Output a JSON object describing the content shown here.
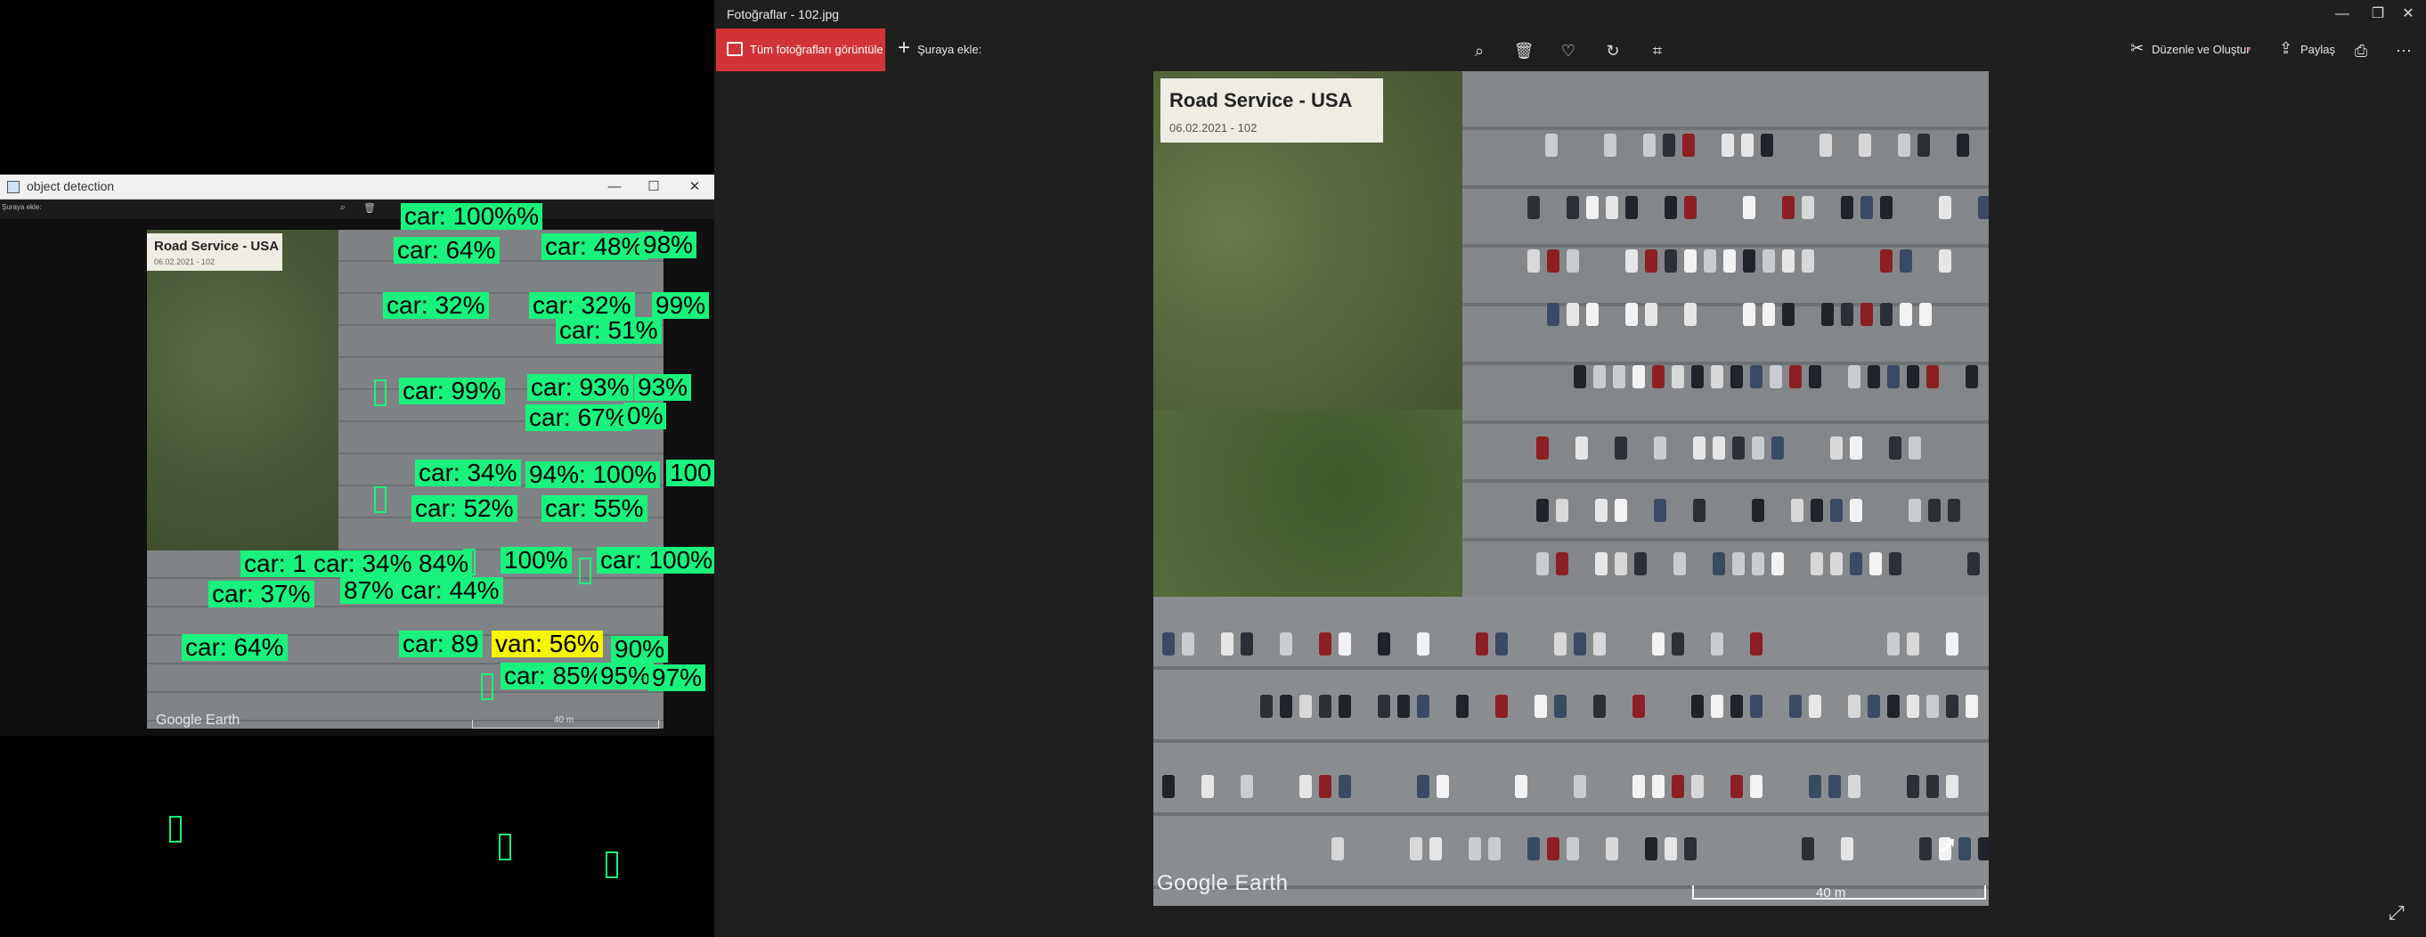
{
  "object_detection_window": {
    "title": "object detection",
    "controls": {
      "minimize": "—",
      "maximize": "☐",
      "close": "✕"
    },
    "mini_toolbar_text": "Şuraya ekle:",
    "image_label": {
      "title": "Road Service - USA",
      "date": "06.02.2021 - 102"
    },
    "google_earth": "Google Earth",
    "scale": "40 m",
    "detections": [
      "car: 100%%",
      "car: 64%",
      "car: 48%",
      "98%",
      "car: 32%",
      "car: 32%",
      "99%",
      "car: 51%",
      "car: 99%",
      "car: 93%",
      "93%",
      "car: 67%",
      "0%",
      "car: 34%",
      "94%: 100%",
      "100",
      "car: 52%",
      "car: 55%",
      "car: 1",
      "car: 34%",
      "84%",
      "100%",
      "car: 100%",
      "car: 37%",
      "87%",
      "car: 44%",
      "car: 64%",
      "car: 89",
      "van: 56%",
      "90%",
      "car: 85%",
      "95%",
      "97%"
    ]
  },
  "photos_window": {
    "title": "Fotoğraflar - 102.jpg",
    "window_controls": {
      "minimize": "—",
      "restore": "❐",
      "close": "✕"
    },
    "toolbar": {
      "all_photos": "Tüm fotoğrafları görüntüle",
      "add_to": "Şuraya ekle:",
      "edit_create": "Düzenle ve Oluştur",
      "share": "Paylaş",
      "tools": [
        "zoom-icon",
        "delete-icon",
        "heart-icon",
        "rotate-icon",
        "crop-icon",
        "print-icon",
        "more-icon"
      ]
    },
    "image_label": {
      "title": "Road Service - USA",
      "date": "06.02.2021 - 102"
    },
    "google_earth": "Google Earth",
    "scale": "40 m"
  },
  "colors": {
    "accent_red": "#d13438",
    "detection_green": "#19f27c",
    "detection_yellow": "#f6f600",
    "app_background": "#1f1f1f"
  }
}
